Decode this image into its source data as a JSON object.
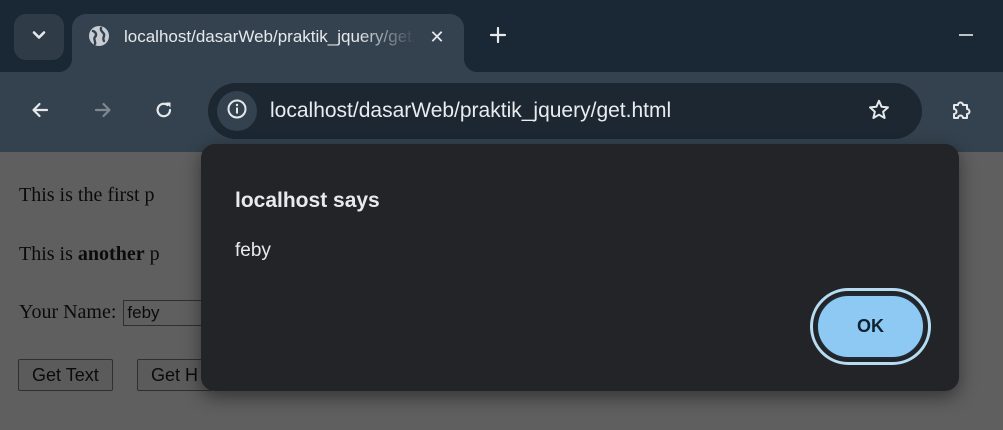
{
  "browser": {
    "tab": {
      "title": "localhost/dasarWeb/praktik_jquery/get.html",
      "close_glyph": "✕",
      "favicon": "globe-icon"
    },
    "new_tab_icon": "plus-icon",
    "minimize_icon": "minimize-icon",
    "tab_search_icon": "chevron-down-icon",
    "toolbar": {
      "back_icon": "arrow-left-icon",
      "forward_icon": "arrow-right-icon",
      "reload_icon": "reload-icon",
      "site_info_icon": "info-icon",
      "bookmark_icon": "star-icon",
      "extensions_icon": "puzzle-icon"
    },
    "omnibox": {
      "url": "localhost/dasarWeb/praktik_jquery/get.html"
    }
  },
  "page": {
    "para1": "This is the first p",
    "para2_prefix": "This is ",
    "para2_bold": "another",
    "para2_suffix": " p",
    "name_label": "Your Name: ",
    "name_value": "feby",
    "buttons": {
      "get_text": "Get Text",
      "get_html": "Get H"
    }
  },
  "dialog": {
    "title": "localhost says",
    "message": "feby",
    "ok_label": "OK"
  },
  "colors": {
    "tabstrip_bg": "#1a2734",
    "toolbar_bg": "#34424f",
    "omnibox_bg": "#1c2731",
    "page_dimmed_bg": "#5f5f5f",
    "dialog_bg": "#222427",
    "ok_button_bg": "#8ec9f3",
    "ok_button_ring": "#b6dcf3"
  }
}
